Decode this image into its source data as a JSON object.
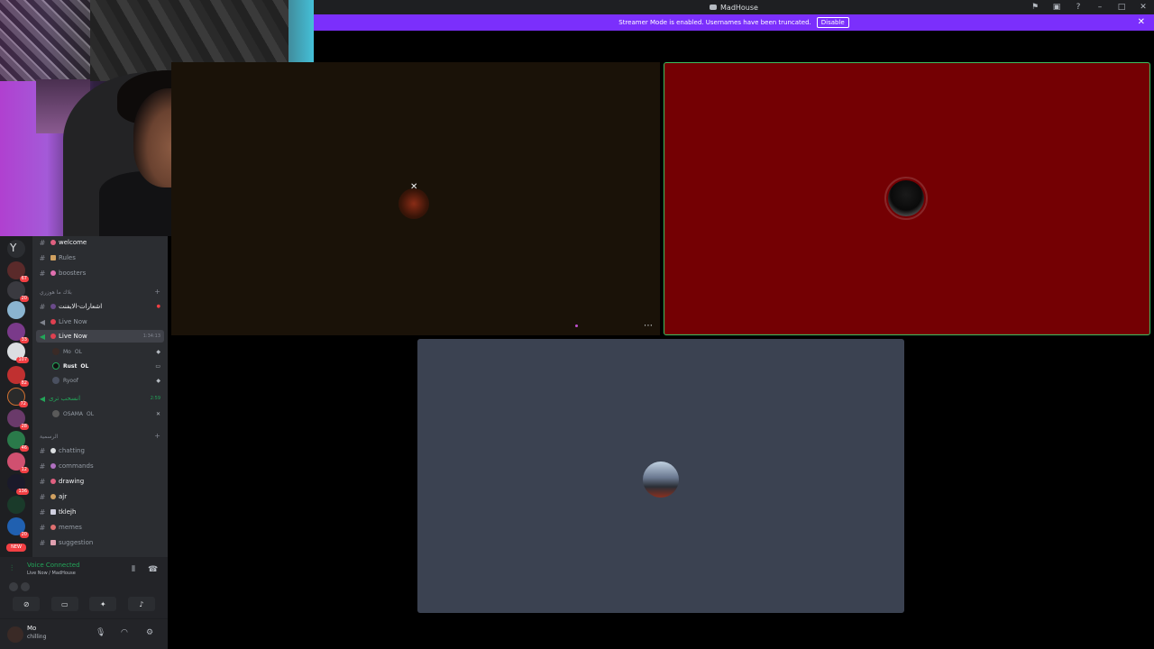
{
  "window": {
    "title": "MadHouse",
    "controls": [
      "flag-icon",
      "inbox-icon",
      "help-icon",
      "minimize-icon",
      "maximize-icon",
      "close-icon"
    ]
  },
  "streamer_bar": {
    "message": "Streamer Mode is enabled. Usernames have been truncated.",
    "button": "Disable",
    "color": "#7b2ffc"
  },
  "servers": [
    {
      "badge": ""
    },
    {
      "badge": "67"
    },
    {
      "badge": "20"
    },
    {
      "badge": ""
    },
    {
      "badge": "33"
    },
    {
      "badge": "107"
    },
    {
      "badge": "82"
    },
    {
      "badge": "72"
    },
    {
      "badge": "28"
    },
    {
      "badge": "46"
    },
    {
      "badge": "12"
    },
    {
      "badge": "136"
    },
    {
      "badge": ""
    },
    {
      "badge": "20"
    }
  ],
  "new_label": "NEW",
  "channels": {
    "welcome": "welcome",
    "rules": "Rules",
    "boosters": "boosters",
    "cat_voice": "بلاك ما هوزري",
    "notify": "اشعارات-الايفنت",
    "live1": "Live Now",
    "live2": "Live Now",
    "live2_time": "1:34:13",
    "users": [
      {
        "name": "Mo",
        "tag": "OL"
      },
      {
        "name": "Rust",
        "tag": "OL"
      },
      {
        "name": "Ryoof",
        "tag": ""
      }
    ],
    "afk_channel": "انسحب ترى",
    "afk_time": "2:59",
    "afk_user": "OSAMA",
    "afk_tag": "OL",
    "cat_text": "الرسمية",
    "chatting": "chatting",
    "commands": "commands",
    "drawing": "drawing",
    "ajr": "ajr",
    "tklejh": "tklejh",
    "memes": "memes",
    "suggestion": "suggestion"
  },
  "voice": {
    "status": "Voice Connected",
    "location": "Live Now / MadHouse",
    "status_color": "#23a559"
  },
  "user": {
    "name": "Mo",
    "status": "chilling"
  },
  "tiles": [
    {
      "bg": "#1a1208"
    },
    {
      "bg": "#740003",
      "speaking": true
    },
    {
      "bg": "#3b4251"
    }
  ]
}
